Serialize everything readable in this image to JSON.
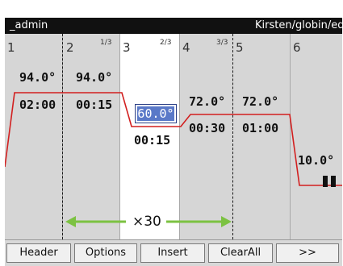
{
  "title_bar": {
    "left": "_admin",
    "right": "Kirsten/globin/edit"
  },
  "steps": [
    {
      "number": "1",
      "fraction": ""
    },
    {
      "number": "2",
      "fraction": "1/3"
    },
    {
      "number": "3",
      "fraction": "2/3"
    },
    {
      "number": "4",
      "fraction": "3/3"
    },
    {
      "number": "5",
      "fraction": ""
    },
    {
      "number": "6",
      "fraction": ""
    }
  ],
  "values": {
    "s1_temp": "94.0°",
    "s1_time": "02:00",
    "s2_temp": "94.0°",
    "s2_time": "00:15",
    "s3_temp_edit": "60.0°",
    "s3_time": "00:15",
    "s4_temp": "72.0°",
    "s4_time": "00:30",
    "s5_temp": "72.0°",
    "s5_time": "01:00",
    "s6_temp": "10.0°"
  },
  "repeat": {
    "label": "×30"
  },
  "toolbar": {
    "header": "Header",
    "options": "Options",
    "insert": "Insert",
    "clearall": "ClearAll",
    "more": ">>"
  },
  "colors": {
    "profile_line": "#d21f1f",
    "repeat_arrow": "#7cc242",
    "selection": "#5a79c8"
  }
}
